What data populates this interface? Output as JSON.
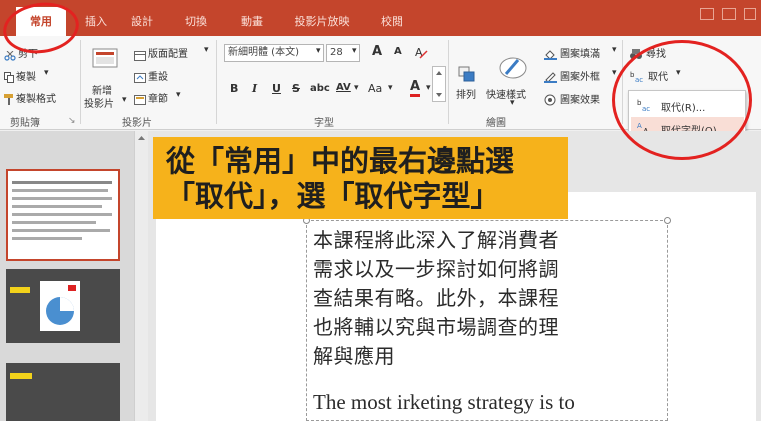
{
  "tabs": [
    "常用",
    "插入",
    "設計",
    "切換",
    "動畫",
    "投影片放映",
    "校閱"
  ],
  "clipboard": {
    "cut": "剪下",
    "copy": "複製",
    "format_painter": "複製格式",
    "group": "剪貼簿"
  },
  "slides": {
    "new_slide": [
      "新增",
      "投影片"
    ],
    "layout": "版面配置",
    "reset": "重設",
    "section": "章節",
    "group": "投影片"
  },
  "font": {
    "name": "新細明體 (本文)",
    "size": "28",
    "bold": "B",
    "italic": "I",
    "underline": "U",
    "strike": "S",
    "shadow": "abc",
    "spacing": "AV",
    "case": "Aa",
    "color": "A",
    "grow": "A",
    "shrink": "A",
    "group": "字型"
  },
  "drawing": {
    "arrange": "排列",
    "quick_styles": "快速樣式",
    "shape_fill": "圖案填滿",
    "shape_outline": "圖案外框",
    "shape_effects": "圖案效果",
    "group": "繪圖"
  },
  "editing": {
    "find": "尋找",
    "replace": "取代"
  },
  "replace_menu": {
    "replace": "取代(R)...",
    "replace_fonts": "取代字型(O)..."
  },
  "callout": {
    "line1": "從「常用」中的最右邊點選",
    "line2": "「取代」，選「取代字型」"
  },
  "slide_text": {
    "lines": [
      "本課程將此深入了解消費者",
      "需求以及一步探討如何將調",
      "查結果有略。此外，本課程",
      "也將輔以究與市場調查的理",
      "解與應用"
    ],
    "english": "The most irketing strategy is to"
  },
  "colors": {
    "accent": "#c4452c",
    "callout": "#f6b21b",
    "ring": "#e32220"
  }
}
